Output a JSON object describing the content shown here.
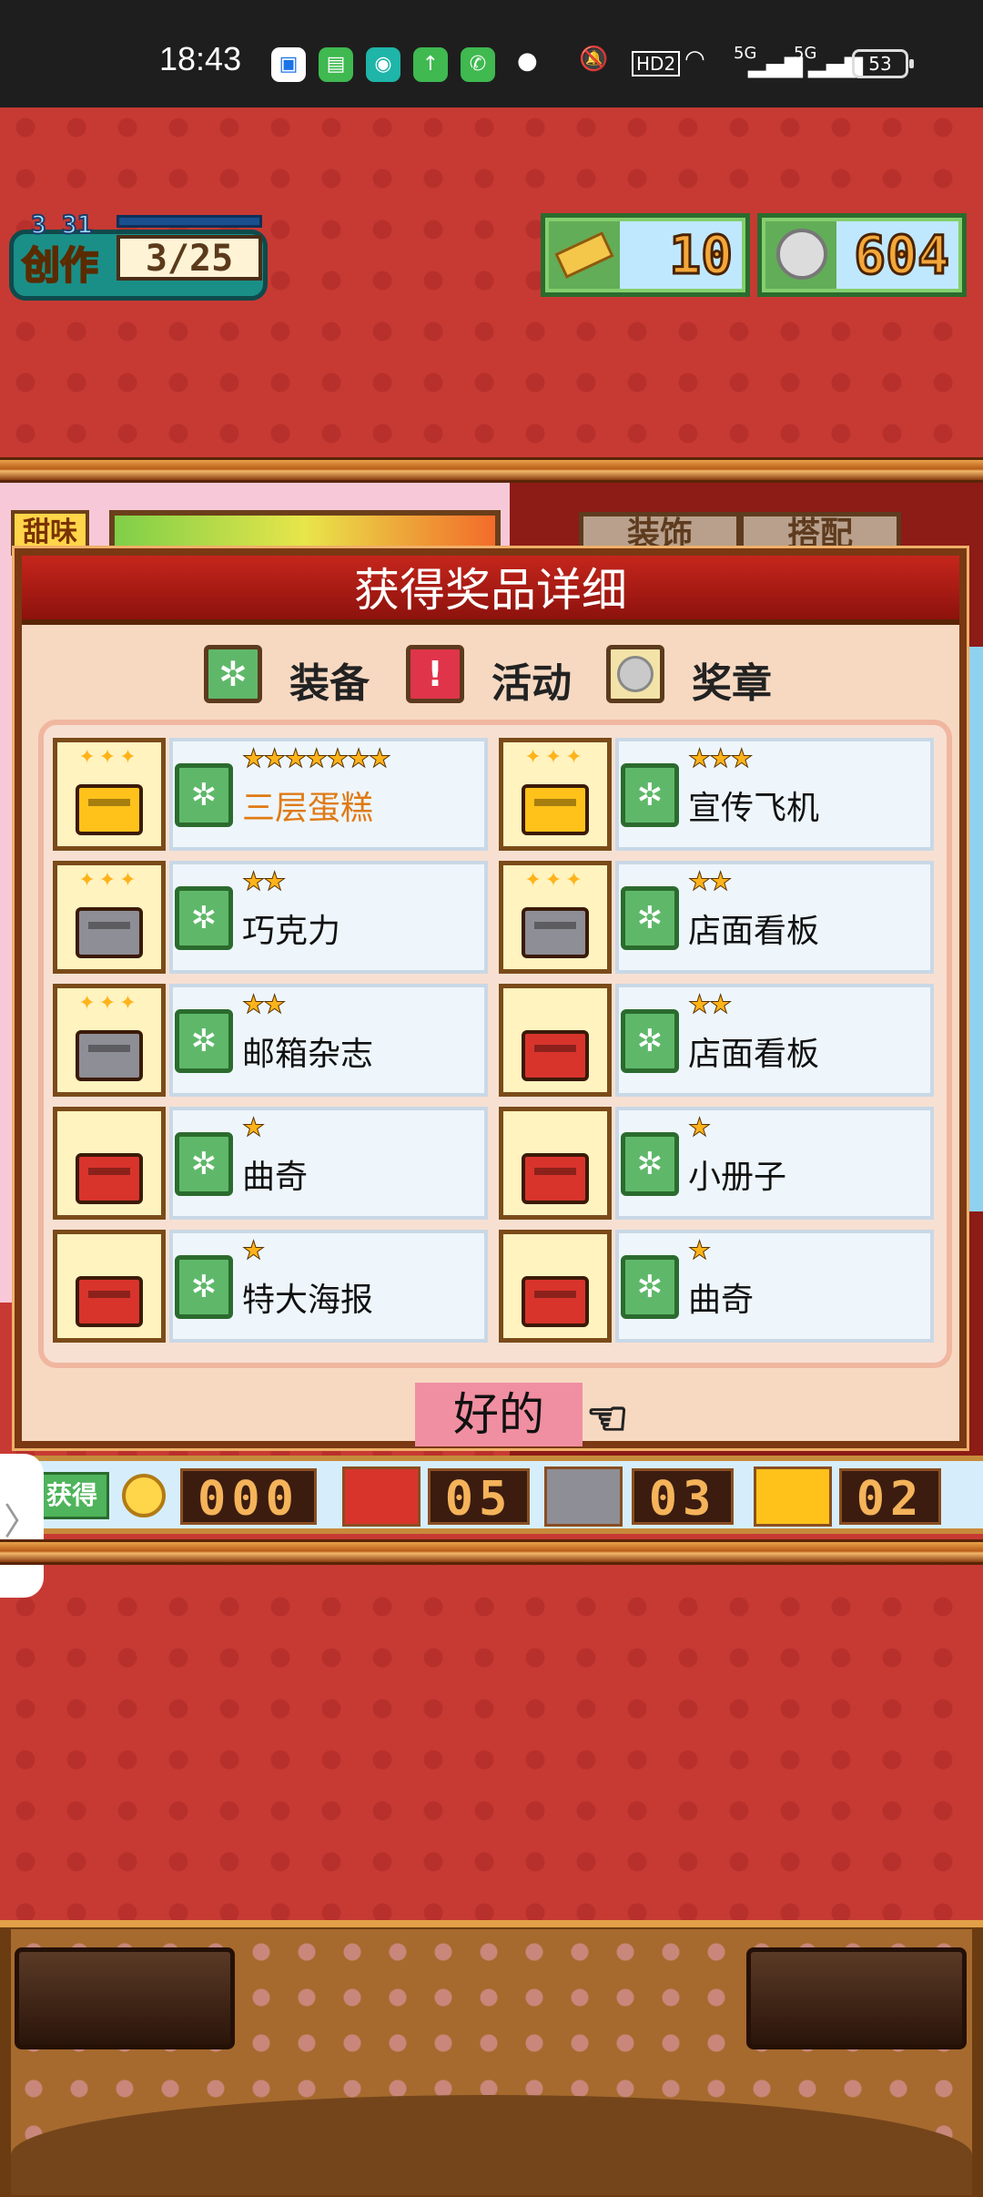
{
  "status_bar": {
    "time": "18:43",
    "notification_icons": [
      "app-icon",
      "message-icon",
      "chat-icon",
      "upload-icon",
      "phone-icon"
    ],
    "signal_labels": [
      "HD2",
      "5G",
      "5G"
    ],
    "battery": "53"
  },
  "hud": {
    "level": "3 31",
    "create_label": "创作",
    "create_count": "3/25",
    "ticket_count": "10",
    "coin_count": "604"
  },
  "background": {
    "tag_label": "甜味",
    "tab_labels": [
      "装饰",
      "搭配"
    ]
  },
  "modal": {
    "title": "获得奖品详细",
    "legend": [
      {
        "label": "装备",
        "icon": "gear-icon",
        "color": "#5fb86a"
      },
      {
        "label": "活动",
        "icon": "exclamation-icon",
        "color": "#e0344a"
      },
      {
        "label": "奖章",
        "icon": "medal-icon",
        "color": "#c9c9c9"
      }
    ],
    "prizes": [
      {
        "name": "三层蛋糕",
        "stars": "★★★★★★★",
        "chest": "gold",
        "highlight": true
      },
      {
        "name": "宣传飞机",
        "stars": "★★★",
        "chest": "gold",
        "highlight": false
      },
      {
        "name": "巧克力",
        "stars": "★★",
        "chest": "silver",
        "highlight": false
      },
      {
        "name": "店面看板",
        "stars": "★★",
        "chest": "silver",
        "highlight": false
      },
      {
        "name": "邮箱杂志",
        "stars": "★★",
        "chest": "silver",
        "highlight": false
      },
      {
        "name": "店面看板",
        "stars": "★★",
        "chest": "red",
        "highlight": false
      },
      {
        "name": "曲奇",
        "stars": "★",
        "chest": "red",
        "highlight": false
      },
      {
        "name": "小册子",
        "stars": "★",
        "chest": "red",
        "highlight": false
      },
      {
        "name": "特大海报",
        "stars": "★",
        "chest": "red",
        "highlight": false
      },
      {
        "name": "曲奇",
        "stars": "★",
        "chest": "red",
        "highlight": false
      }
    ],
    "ok_label": "好的"
  },
  "bottom_strip": {
    "acquired_label": "获得",
    "coin_value": "000",
    "red_chest_value": "05",
    "silver_chest_value": "03",
    "gold_chest_value": "02"
  },
  "colors": {
    "chest_gold": "#ffc21a",
    "chest_silver": "#8e8e96",
    "chest_red": "#d8342c",
    "highlight_text": "#e07a16"
  }
}
